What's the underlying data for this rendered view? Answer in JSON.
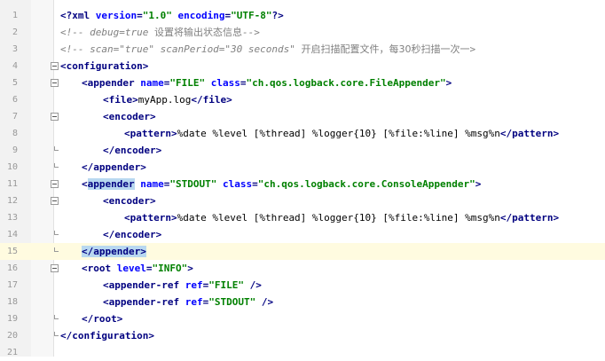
{
  "lines": [
    {
      "n": "1",
      "parts": [
        {
          "c": "tag",
          "t": "<"
        },
        {
          "c": "pi",
          "t": "?xml "
        },
        {
          "c": "attr",
          "t": "version"
        },
        {
          "c": "tag",
          "t": "="
        },
        {
          "c": "val",
          "t": "\"1.0\""
        },
        {
          "c": "attr",
          "t": " encoding"
        },
        {
          "c": "tag",
          "t": "="
        },
        {
          "c": "val",
          "t": "\"UTF-8\""
        },
        {
          "c": "pi",
          "t": "?"
        },
        {
          "c": "tag",
          "t": ">"
        }
      ]
    },
    {
      "n": "2",
      "parts": [
        {
          "c": "comment",
          "t": "<!-- debug=true "
        },
        {
          "c": "cjk",
          "t": "设置将输出状态信息"
        },
        {
          "c": "comment",
          "t": "-->"
        }
      ]
    },
    {
      "n": "3",
      "parts": [
        {
          "c": "comment",
          "t": "<!-- scan=\"true\" scanPeriod=\"30 seconds\" "
        },
        {
          "c": "cjk",
          "t": "开启扫描配置文件，每30秒扫描一次一"
        },
        {
          "c": "comment",
          "t": ">"
        }
      ]
    },
    {
      "n": "4",
      "parts": [
        {
          "c": "tag",
          "t": "<configuration>"
        }
      ]
    },
    {
      "n": "5",
      "parts": [
        {
          "c": "tag",
          "t": "<appender "
        },
        {
          "c": "attr",
          "t": "name"
        },
        {
          "c": "tag",
          "t": "="
        },
        {
          "c": "val",
          "t": "\"FILE\""
        },
        {
          "c": "attr",
          "t": " class"
        },
        {
          "c": "tag",
          "t": "="
        },
        {
          "c": "val",
          "t": "\"ch.qos.logback.core.FileAppender\""
        },
        {
          "c": "tag",
          "t": ">"
        }
      ]
    },
    {
      "n": "6",
      "parts": [
        {
          "c": "tag",
          "t": "<file>"
        },
        {
          "c": "text",
          "t": "myApp.log"
        },
        {
          "c": "tag",
          "t": "</file>"
        }
      ]
    },
    {
      "n": "7",
      "parts": [
        {
          "c": "tag",
          "t": "<encoder>"
        }
      ]
    },
    {
      "n": "8",
      "parts": [
        {
          "c": "tag",
          "t": "<pattern>"
        },
        {
          "c": "text",
          "t": "%date %level [%thread] %logger{10} [%file:%line] %msg%n"
        },
        {
          "c": "tag",
          "t": "</pattern>"
        }
      ]
    },
    {
      "n": "9",
      "parts": [
        {
          "c": "tag",
          "t": "</encoder>"
        }
      ]
    },
    {
      "n": "10",
      "parts": [
        {
          "c": "tag",
          "t": "</appender>"
        }
      ]
    },
    {
      "n": "11",
      "parts": [
        {
          "c": "tag",
          "t": "<"
        },
        {
          "c": "tag hl",
          "t": "appender"
        },
        {
          "c": "attr",
          "t": " name"
        },
        {
          "c": "tag",
          "t": "="
        },
        {
          "c": "val",
          "t": "\"STDOUT\""
        },
        {
          "c": "attr",
          "t": " class"
        },
        {
          "c": "tag",
          "t": "="
        },
        {
          "c": "val",
          "t": "\"ch.qos.logback.core.ConsoleAppender\""
        },
        {
          "c": "tag",
          "t": ">"
        }
      ]
    },
    {
      "n": "12",
      "parts": [
        {
          "c": "tag",
          "t": "<encoder>"
        }
      ]
    },
    {
      "n": "13",
      "parts": [
        {
          "c": "tag",
          "t": "<pattern>"
        },
        {
          "c": "text",
          "t": "%date %level [%thread] %logger{10} [%file:%line] %msg%n"
        },
        {
          "c": "tag",
          "t": "</pattern>"
        }
      ]
    },
    {
      "n": "14",
      "parts": [
        {
          "c": "tag",
          "t": "</encoder>"
        }
      ]
    },
    {
      "n": "15",
      "parts": [
        {
          "c": "tag hl",
          "t": "</appender>"
        }
      ]
    },
    {
      "n": "16",
      "parts": [
        {
          "c": "tag",
          "t": "<root "
        },
        {
          "c": "attr",
          "t": "level"
        },
        {
          "c": "tag",
          "t": "="
        },
        {
          "c": "val",
          "t": "\"INFO\""
        },
        {
          "c": "tag",
          "t": ">"
        }
      ]
    },
    {
      "n": "17",
      "parts": [
        {
          "c": "tag",
          "t": "<appender-ref "
        },
        {
          "c": "attr",
          "t": "ref"
        },
        {
          "c": "tag",
          "t": "="
        },
        {
          "c": "val",
          "t": "\"FILE\""
        },
        {
          "c": "tag",
          "t": " />"
        }
      ]
    },
    {
      "n": "18",
      "parts": [
        {
          "c": "tag",
          "t": "<appender-ref "
        },
        {
          "c": "attr",
          "t": "ref"
        },
        {
          "c": "tag",
          "t": "="
        },
        {
          "c": "val",
          "t": "\"STDOUT\""
        },
        {
          "c": "tag",
          "t": " />"
        }
      ]
    },
    {
      "n": "19",
      "parts": [
        {
          "c": "tag",
          "t": "</root>"
        }
      ]
    },
    {
      "n": "20",
      "parts": [
        {
          "c": "tag",
          "t": "</configuration>"
        }
      ]
    },
    {
      "n": "21",
      "parts": []
    }
  ],
  "colors": {
    "tag": "#000080",
    "attribute": "#0000ff",
    "value": "#008000",
    "comment": "#808080",
    "highlight": "#b8d8f0",
    "current_line": "#fffbe0"
  }
}
